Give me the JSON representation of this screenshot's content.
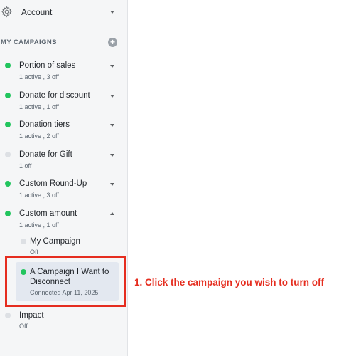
{
  "account": {
    "label": "Account"
  },
  "sidebar": {
    "section_title": "MY CAMPAIGNS",
    "add_icon": "plus-circle-icon",
    "items": [
      {
        "label": "Portion of sales",
        "status": "1 active , 3 off"
      },
      {
        "label": "Donate for discount",
        "status": "1 active , 1 off"
      },
      {
        "label": "Donation tiers",
        "status": "1 active , 2 off"
      },
      {
        "label": "Donate for Gift",
        "status": "1 off"
      },
      {
        "label": "Custom Round-Up",
        "status": "1 active , 3 off"
      },
      {
        "label": "Custom amount",
        "status": "1 active , 1 off"
      },
      {
        "label": "Impact",
        "status": "Off"
      }
    ],
    "sub_items": [
      {
        "label": "My Campaign",
        "status": "Off"
      },
      {
        "label_line1": "A Campaign I Want to",
        "label_line2": "Disconnect",
        "status": "Connected Apr 11, 2025"
      }
    ]
  },
  "annotation": {
    "text": "1. Click the campaign you wish to turn off"
  },
  "colors": {
    "active_dot": "#22c55e",
    "inactive_dot": "#dde0e4",
    "annotation_red": "#e52d1f",
    "selected_bg": "#e3e8f0"
  }
}
